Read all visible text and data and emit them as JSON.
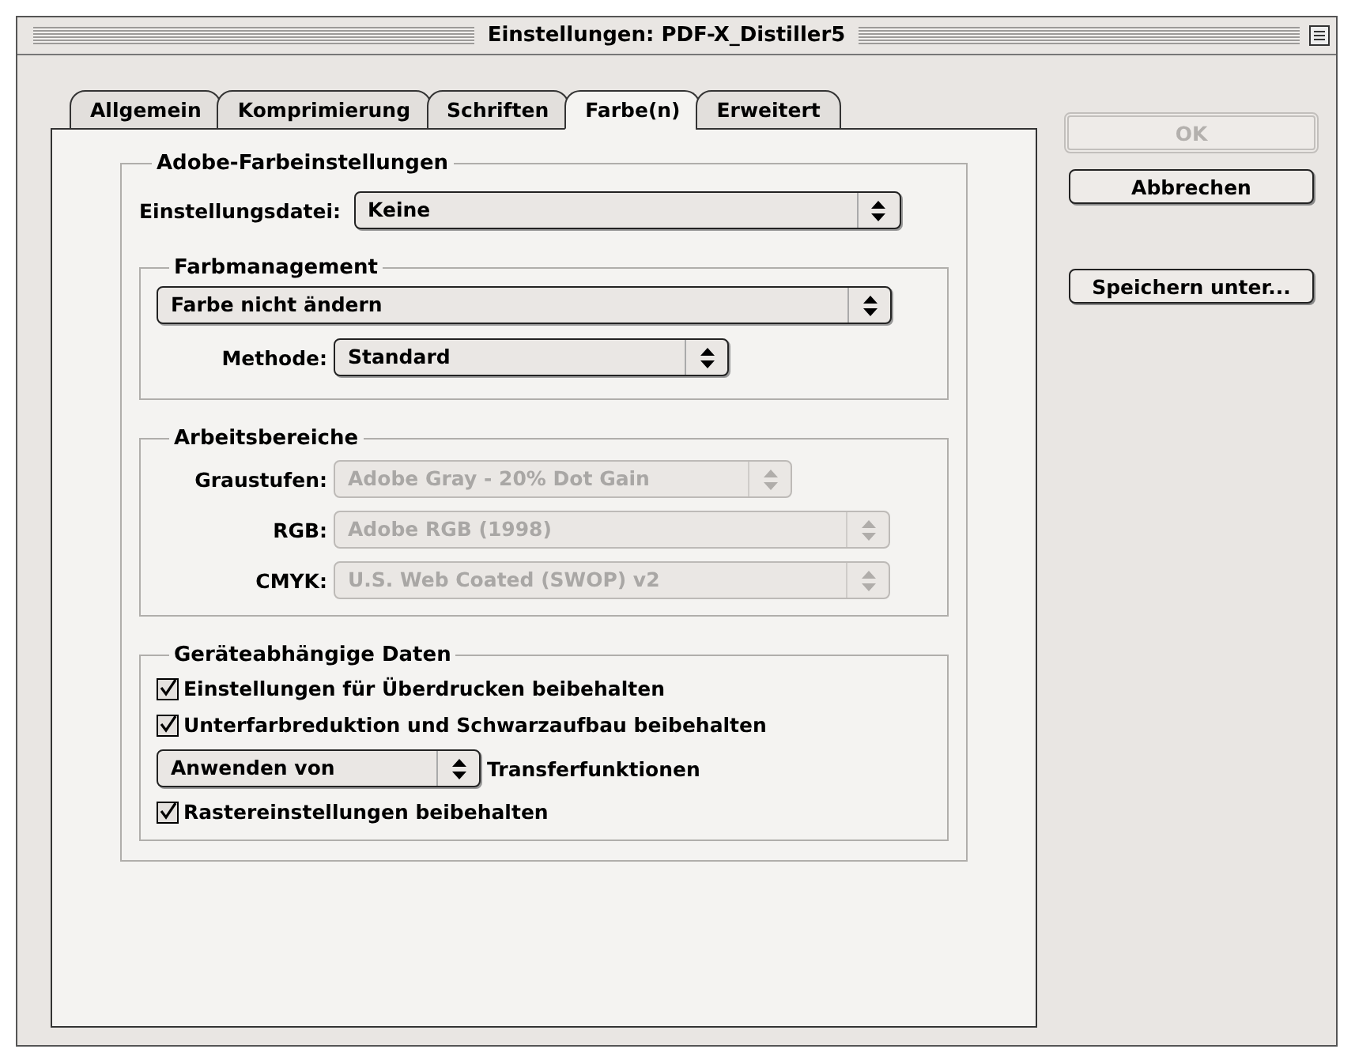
{
  "window": {
    "title": "Einstellungen: PDF-X_Distiller5"
  },
  "tabs": [
    {
      "label": "Allgemein",
      "selected": false
    },
    {
      "label": "Komprimierung",
      "selected": false
    },
    {
      "label": "Schriften",
      "selected": false
    },
    {
      "label": "Farbe(n)",
      "selected": true
    },
    {
      "label": "Erweitert",
      "selected": false
    }
  ],
  "color_settings": {
    "title": "Adobe-Farbeinstellungen",
    "settings_file": {
      "label": "Einstellungsdatei:",
      "value": "Keine",
      "disabled": false
    }
  },
  "color_management": {
    "title": "Farbmanagement",
    "policy": {
      "value": "Farbe nicht ändern",
      "disabled": false
    },
    "method": {
      "label": "Methode:",
      "value": "Standard",
      "disabled": false
    }
  },
  "working_spaces": {
    "title": "Arbeitsbereiche",
    "fields": [
      {
        "label": "Graustufen:",
        "value": "Adobe Gray - 20% Dot Gain",
        "disabled": true
      },
      {
        "label": "RGB:",
        "value": "Adobe RGB (1998)",
        "disabled": true
      },
      {
        "label": "CMYK:",
        "value": "U.S. Web Coated (SWOP) v2",
        "disabled": true
      }
    ]
  },
  "device_data": {
    "title": "Geräteabhängige Daten",
    "items": [
      {
        "kind": "checkbox",
        "label": "Einstellungen für Überdrucken beibehalten",
        "checked": true
      },
      {
        "kind": "checkbox",
        "label": "Unterfarbreduktion und Schwarzaufbau beibehalten",
        "checked": true
      },
      {
        "kind": "select",
        "value": "Anwenden von",
        "suffix": "Transferfunktionen",
        "disabled": false
      },
      {
        "kind": "checkbox",
        "label": "Rastereinstellungen beibehalten",
        "checked": true
      }
    ]
  },
  "buttons": [
    {
      "label": "OK",
      "disabled": true
    },
    {
      "label": "Abbrechen",
      "disabled": false
    },
    {
      "label": "Speichern unter...",
      "disabled": false
    }
  ]
}
